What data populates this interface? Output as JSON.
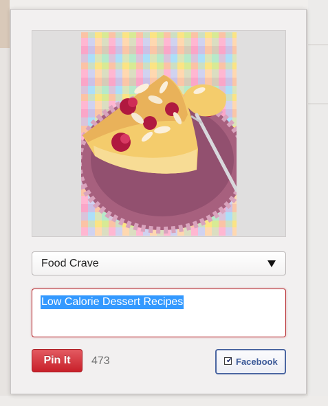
{
  "pin_dialog": {
    "image": {
      "alt": "Raspberry almond cake slice on a pink plate"
    },
    "board_select": {
      "selected_value": "Food Crave"
    },
    "description": {
      "value": "Low Calorie Dessert Recipes"
    },
    "pin_button_label": "Pin It",
    "char_count": "473",
    "facebook": {
      "label": "Facebook",
      "checked": true
    }
  },
  "colors": {
    "pin_red": "#c8202a",
    "facebook_blue": "#3b5998",
    "selection_blue": "#3399ff"
  }
}
